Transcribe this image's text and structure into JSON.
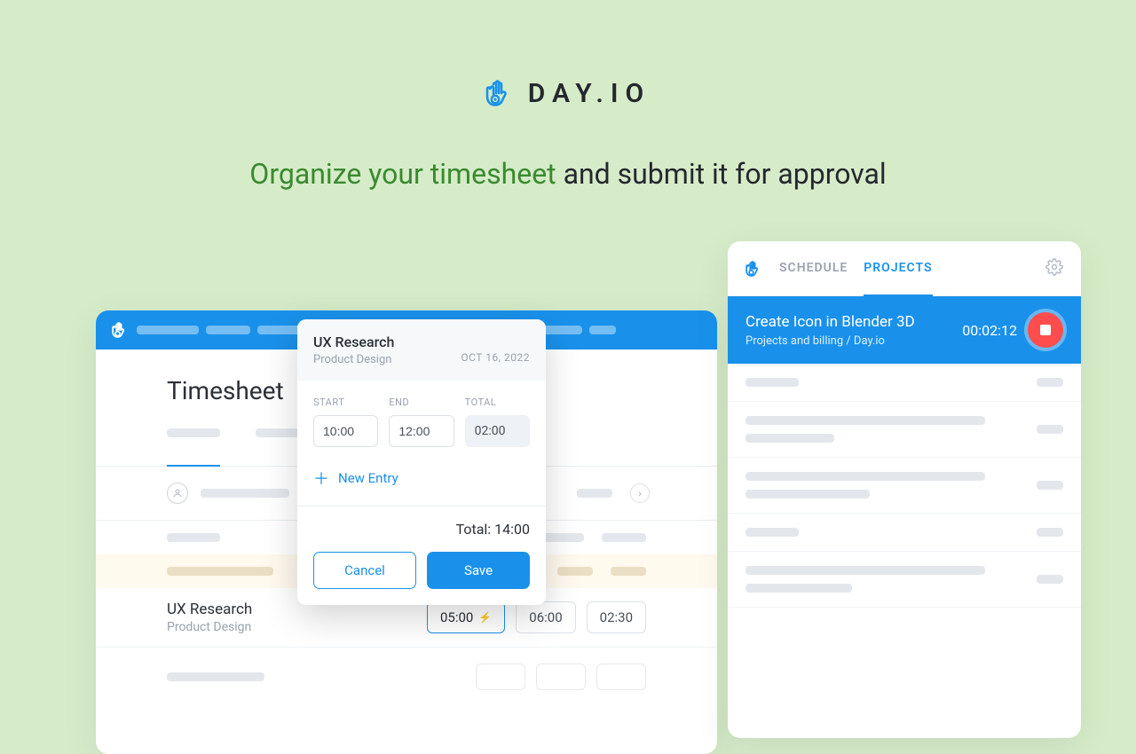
{
  "brand": {
    "name": "DAY.IO"
  },
  "tagline": {
    "highlight": "Organize your timesheet",
    "rest": " and submit it for approval"
  },
  "timesheet": {
    "title": "Timesheet",
    "row": {
      "task": "UX Research",
      "project": "Product Design",
      "t1": "05:00",
      "t2": "06:00",
      "t3": "02:30"
    }
  },
  "modal": {
    "task": "UX Research",
    "project": "Product Design",
    "date": "OCT 16, 2022",
    "labels": {
      "start": "START",
      "end": "END",
      "total": "TOTAL"
    },
    "start": "10:00",
    "end": "12:00",
    "total": "02:00",
    "new_entry": "New Entry",
    "grand_total_label": "Total: ",
    "grand_total": "14:00",
    "cancel": "Cancel",
    "save": "Save"
  },
  "right": {
    "tabs": {
      "schedule": "SCHEDULE",
      "projects": "PROJECTS"
    },
    "tracker": {
      "title": "Create Icon in Blender 3D",
      "breadcrumb": "Projects and billing / Day.io",
      "elapsed": "00:02:12"
    }
  }
}
